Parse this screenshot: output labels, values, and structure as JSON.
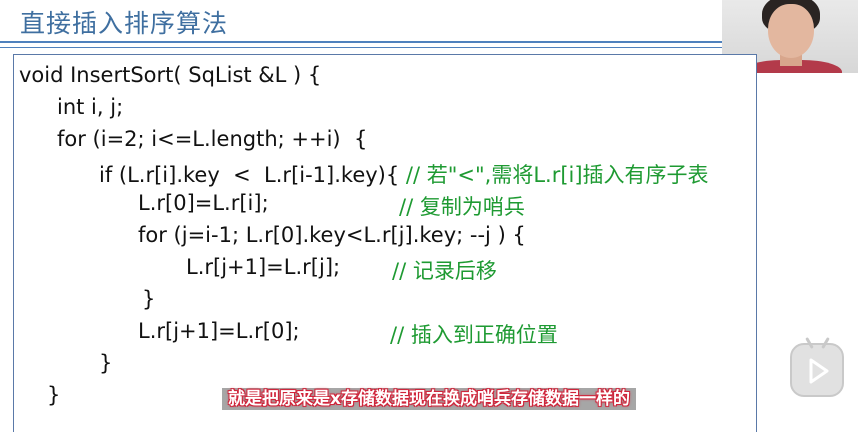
{
  "slide": {
    "title": "直接插入排序算法"
  },
  "code": {
    "lines": [
      {
        "code": "void InsertSort( SqList &L ) {",
        "comment": ""
      },
      {
        "code": "int i, j;",
        "comment": ""
      },
      {
        "code": "for (i=2; i<=L.length; ++i)  {",
        "comment": ""
      },
      {
        "code": "if (L.r[i].key  <  L.r[i-1].key){",
        "comment": "// 若\"<\",需将L.r[i]插入有序子表"
      },
      {
        "code": "L.r[0]=L.r[i];",
        "comment": "// 复制为哨兵"
      },
      {
        "code": "for (j=i-1; L.r[0].key<L.r[j].key; --j ) {",
        "comment": ""
      },
      {
        "code": "L.r[j+1]=L.r[j];",
        "comment": "// 记录后移"
      },
      {
        "code": "}",
        "comment": ""
      },
      {
        "code": "L.r[j+1]=L.r[0];",
        "comment": "// 插入到正确位置"
      },
      {
        "code": "}",
        "comment": ""
      },
      {
        "code": "}",
        "comment": ""
      }
    ]
  },
  "subtitle": {
    "text": "就是把原来是x存储数据现在换成哨兵存储数据一样的"
  },
  "colors": {
    "title": "#3f6fa0",
    "comment": "#1e9a32",
    "subtitle_outline": "#d0243a",
    "rule": "#4f81bd"
  },
  "icons": {
    "player": "tv-play-icon"
  }
}
